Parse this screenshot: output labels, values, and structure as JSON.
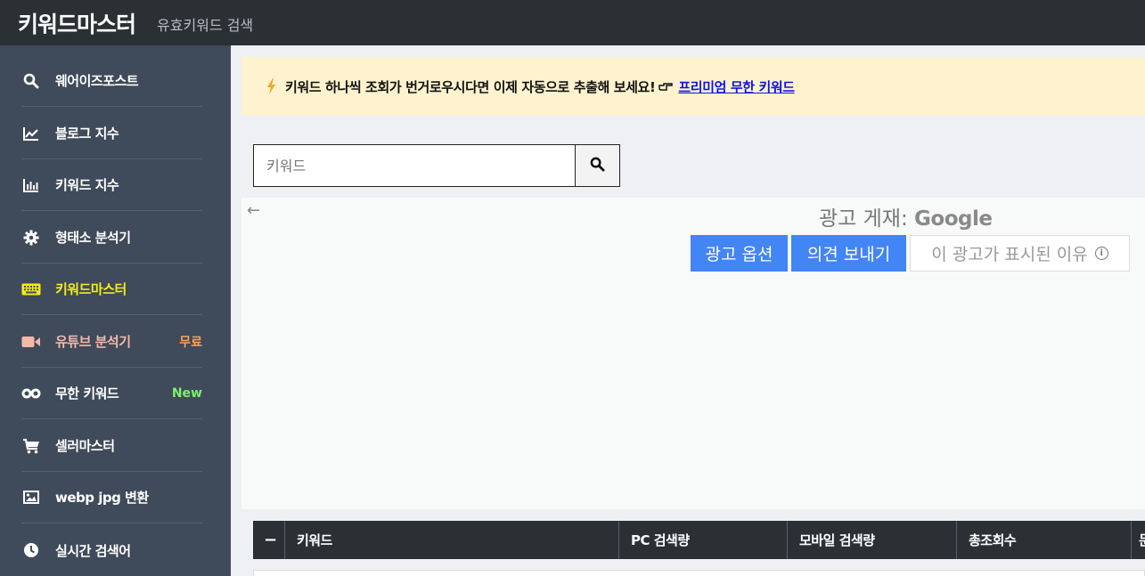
{
  "header": {
    "brand": "키워드마스터",
    "subtitle": "유효키워드 검색"
  },
  "sidebar": {
    "items": [
      {
        "label": "웨어이즈포스트",
        "icon": "search-icon",
        "color": "#ffffff",
        "badge": ""
      },
      {
        "label": "블로그 지수",
        "icon": "line-chart-icon",
        "color": "#ffffff",
        "badge": ""
      },
      {
        "label": "키워드 지수",
        "icon": "bar-chart-icon",
        "color": "#ffffff",
        "badge": ""
      },
      {
        "label": "형태소 분석기",
        "icon": "gear-icon",
        "color": "#ffffff",
        "badge": ""
      },
      {
        "label": "키워드마스터",
        "icon": "keyboard-icon",
        "color": "#f3ec19",
        "badge": ""
      },
      {
        "label": "유튜브 분석기",
        "icon": "video-camera-icon",
        "color": "#f6b9a8",
        "badge": "무료",
        "badge_color": "#f5a35c"
      },
      {
        "label": "무한 키워드",
        "icon": "infinity-icon",
        "color": "#ffffff",
        "badge": "New",
        "badge_color": "#7ff06a"
      },
      {
        "label": "셀러마스터",
        "icon": "cart-icon",
        "color": "#ffffff",
        "badge": ""
      },
      {
        "label": "webp jpg 변환",
        "icon": "image-icon",
        "color": "#ffffff",
        "badge": ""
      },
      {
        "label": "실시간 검색어",
        "icon": "clock-icon",
        "color": "#ffffff",
        "badge": ""
      }
    ]
  },
  "notice": {
    "text": "키워드 하나씩 조회가 번거로우시다면 이제 자동으로 추출해 보세요!",
    "link": "프리미엄 무한 키워드",
    "accent": "#f5a623"
  },
  "search": {
    "placeholder": "키워드",
    "value": ""
  },
  "ad": {
    "back": "←",
    "by_prefix": "광고 게재:",
    "by_brand": "Google",
    "options": "광고 옵션",
    "feedback": "의견 보내기",
    "why": "이 광고가 표시된 이유"
  },
  "table": {
    "headers": [
      "−",
      "키워드",
      "PC 검색량",
      "모바일 검색량",
      "총조회수",
      "문"
    ]
  }
}
